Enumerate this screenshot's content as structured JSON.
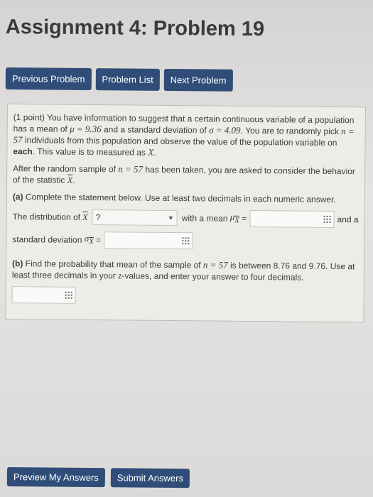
{
  "page": {
    "title": "Assignment 4: Problem 19"
  },
  "nav": {
    "previous": "Previous Problem",
    "list": "Problem List",
    "next": "Next Problem"
  },
  "problem": {
    "points": "(1 point)",
    "intro_1": "You have information to suggest that a certain continuous variable of a population has a mean of",
    "mu_text": "μ = 9.36",
    "intro_2": "and a standard deviation of",
    "sigma_text": "σ = 4.09",
    "intro_3": ". You are to randomly pick",
    "n_text": "n = 57",
    "intro_4": "individuals from this population and observe the value of the population variable on",
    "each": "each",
    "intro_5": ". This value is to measured as",
    "x_var": "X",
    "intro_5b": ".",
    "after_1": "After the random sample of",
    "after_n": "n = 57",
    "after_2": "has been taken, you are asked to consider the behavior of the statistic",
    "statistic": "X",
    "statistic_end": ".",
    "part_a_label": "(a)",
    "part_a_text": "Complete the statement below. Use at least two decimals in each numeric answer.",
    "dist_label": "The distribution of",
    "dist_xbar": "X",
    "select_value": "?",
    "mean_label": "with a mean",
    "mean_sym": "μ",
    "mean_sub": "X",
    "eq": "=",
    "and_a": "and a",
    "sd_label": "standard deviation",
    "sd_sym": "σ",
    "sd_sub": "X",
    "part_b_label": "(b)",
    "part_b_1": "Find the probability that mean of the sample of",
    "part_b_n": "n = 57",
    "part_b_2": "is between 8.76 and 9.76. Use at least three decimals in your",
    "part_b_z": "z",
    "part_b_3": "-values, and enter your answer to four decimals."
  },
  "actions": {
    "preview": "Preview My Answers",
    "submit": "Submit Answers"
  }
}
